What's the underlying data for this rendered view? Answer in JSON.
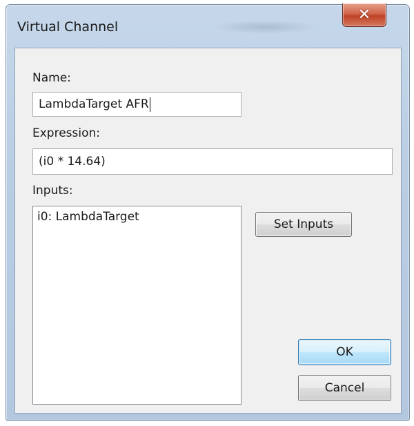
{
  "window": {
    "title": "Virtual Channel",
    "close_glyph": "✕"
  },
  "form": {
    "name_label": "Name:",
    "name_value": "LambdaTarget AFR",
    "expression_label": "Expression:",
    "expression_value": "(i0 * 14.64)",
    "inputs_label": "Inputs:",
    "inputs": [
      {
        "label": "i0: LambdaTarget"
      }
    ]
  },
  "buttons": {
    "set_inputs": "Set Inputs",
    "ok": "OK",
    "cancel": "Cancel"
  },
  "colors": {
    "titlebar": "#b9cde3",
    "close_button": "#c84a30",
    "client_background": "#f0f0f0",
    "default_button_border": "#3c7fb1"
  },
  "icons": {
    "close": "close-icon"
  }
}
